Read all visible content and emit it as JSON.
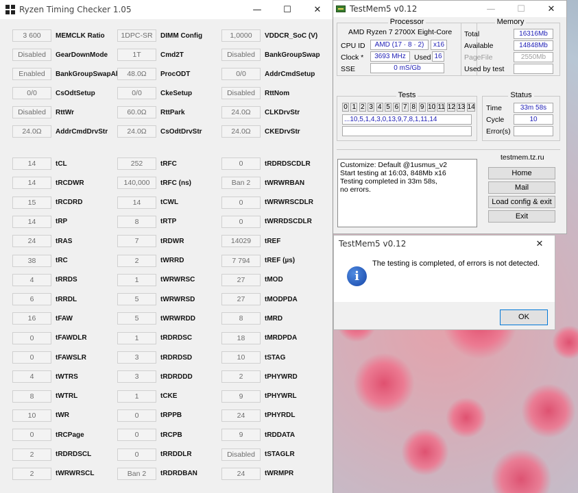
{
  "rtc": {
    "title": "Ryzen Timing Checker 1.05",
    "controls": {
      "minimize": "—",
      "maximize": "☐",
      "close": "✕"
    },
    "top_cols": [
      [
        {
          "v": "3 600",
          "l": "MEMCLK Ratio"
        },
        {
          "v": "Disabled",
          "l": "GearDownMode"
        },
        {
          "v": "Enabled",
          "l": "BankGroupSwapAlt"
        },
        {
          "v": "0/0",
          "l": "CsOdtSetup"
        },
        {
          "v": "Disabled",
          "l": "RttWr"
        },
        {
          "v": "24.0Ω",
          "l": "AddrCmdDrvStr"
        }
      ],
      [
        {
          "v": "1DPC-SR",
          "l": "DIMM Config"
        },
        {
          "v": "1T",
          "l": "Cmd2T"
        },
        {
          "v": "48.0Ω",
          "l": "ProcODT"
        },
        {
          "v": "0/0",
          "l": "CkeSetup"
        },
        {
          "v": "60.0Ω",
          "l": "RttPark"
        },
        {
          "v": "24.0Ω",
          "l": "CsOdtDrvStr"
        }
      ],
      [
        {
          "v": "1,0000",
          "l": "VDDCR_SoC (V)"
        },
        {
          "v": "Disabled",
          "l": "BankGroupSwap"
        },
        {
          "v": "0/0",
          "l": "AddrCmdSetup"
        },
        {
          "v": "Disabled",
          "l": "RttNom"
        },
        {
          "v": "24.0Ω",
          "l": "CLKDrvStr"
        },
        {
          "v": "24.0Ω",
          "l": "CKEDrvStr"
        }
      ]
    ],
    "bottom_cols": [
      [
        {
          "v": "14",
          "l": "tCL"
        },
        {
          "v": "14",
          "l": "tRCDWR"
        },
        {
          "v": "15",
          "l": "tRCDRD"
        },
        {
          "v": "14",
          "l": "tRP"
        },
        {
          "v": "24",
          "l": "tRAS"
        },
        {
          "v": "38",
          "l": "tRC"
        },
        {
          "v": "4",
          "l": "tRRDS"
        },
        {
          "v": "6",
          "l": "tRRDL"
        },
        {
          "v": "16",
          "l": "tFAW"
        },
        {
          "v": "0",
          "l": "tFAWDLR"
        },
        {
          "v": "0",
          "l": "tFAWSLR"
        },
        {
          "v": "4",
          "l": "tWTRS"
        },
        {
          "v": "8",
          "l": "tWTRL"
        },
        {
          "v": "10",
          "l": "tWR"
        },
        {
          "v": "0",
          "l": "tRCPage"
        },
        {
          "v": "2",
          "l": "tRDRDSCL"
        },
        {
          "v": "2",
          "l": "tWRWRSCL"
        }
      ],
      [
        {
          "v": "252",
          "l": "tRFC"
        },
        {
          "v": "140,000",
          "l": "tRFC (ns)"
        },
        {
          "v": "14",
          "l": "tCWL"
        },
        {
          "v": "8",
          "l": "tRTP"
        },
        {
          "v": "7",
          "l": "tRDWR"
        },
        {
          "v": "2",
          "l": "tWRRD"
        },
        {
          "v": "1",
          "l": "tWRWRSC"
        },
        {
          "v": "5",
          "l": "tWRWRSD"
        },
        {
          "v": "5",
          "l": "tWRWRDD"
        },
        {
          "v": "1",
          "l": "tRDRDSC"
        },
        {
          "v": "3",
          "l": "tRDRDSD"
        },
        {
          "v": "3",
          "l": "tRDRDDD"
        },
        {
          "v": "1",
          "l": "tCKE"
        },
        {
          "v": "0",
          "l": "tRPPB"
        },
        {
          "v": "0",
          "l": "tRCPB"
        },
        {
          "v": "0",
          "l": "tRRDDLR"
        },
        {
          "v": "Ban 2",
          "l": "tRDRDBAN"
        }
      ],
      [
        {
          "v": "0",
          "l": "tRDRDSCDLR"
        },
        {
          "v": "Ban 2",
          "l": "tWRWRBAN"
        },
        {
          "v": "0",
          "l": "tWRWRSCDLR"
        },
        {
          "v": "0",
          "l": "tWRRDSCDLR"
        },
        {
          "v": "14029",
          "l": "tREF"
        },
        {
          "v": "7 794",
          "l": "tREF (µs)"
        },
        {
          "v": "27",
          "l": "tMOD"
        },
        {
          "v": "27",
          "l": "tMODPDA"
        },
        {
          "v": "8",
          "l": "tMRD"
        },
        {
          "v": "18",
          "l": "tMRDPDA"
        },
        {
          "v": "10",
          "l": "tSTAG"
        },
        {
          "v": "2",
          "l": "tPHYWRD"
        },
        {
          "v": "9",
          "l": "tPHYWRL"
        },
        {
          "v": "24",
          "l": "tPHYRDL"
        },
        {
          "v": "9",
          "l": "tRDDATA"
        },
        {
          "v": "Disabled",
          "l": "tSTAGLR"
        },
        {
          "v": "24",
          "l": "tWRMPR"
        }
      ]
    ]
  },
  "tm5": {
    "title": "TestMem5 v0.12",
    "controls": {
      "minimize": "—",
      "maximize": "☐",
      "close": "✕"
    },
    "processor": {
      "caption": "Processor",
      "name": "AMD Ryzen 7 2700X Eight-Core",
      "cpuid_label": "CPU ID",
      "cpuid": "AMD  (17 · 8 · 2)",
      "threads": "x16",
      "clock_label": "Clock *",
      "clock": "3693 MHz",
      "used_label": "Used",
      "used": "16",
      "sse_label": "SSE",
      "sse": "0 mS/Gb"
    },
    "memory": {
      "caption": "Memory",
      "total_label": "Total",
      "total": "16316Mb",
      "available_label": "Available",
      "available": "14848Mb",
      "pagefile_label": "PageFile",
      "pagefile": "2550Mb",
      "usedbytest_label": "Used by test"
    },
    "tests": {
      "caption": "Tests",
      "numbers": [
        "0",
        "1",
        "2",
        "3",
        "4",
        "5",
        "6",
        "7",
        "8",
        "9",
        "10",
        "11",
        "12",
        "13",
        "14"
      ],
      "sequence": "...10,5,1,4,3,0,13,9,7,8,1,11,14"
    },
    "status": {
      "caption": "Status",
      "time_label": "Time",
      "time": "33m 58s",
      "cycle_label": "Cycle",
      "cycle": "10",
      "errors_label": "Error(s)"
    },
    "site": "testmem.tz.ru",
    "log": "Customize: Default @1usmus_v2\nStart testing at 16:03, 848Mb x16\nTesting completed in 33m 58s,\nno errors.",
    "buttons": {
      "home": "Home",
      "mail": "Mail",
      "load": "Load config & exit",
      "exit": "Exit"
    }
  },
  "dialog": {
    "title": "TestMem5 v0.12",
    "close": "✕",
    "icon": "i",
    "message": "The testing is completed, of errors is not detected.",
    "ok": "OK"
  }
}
